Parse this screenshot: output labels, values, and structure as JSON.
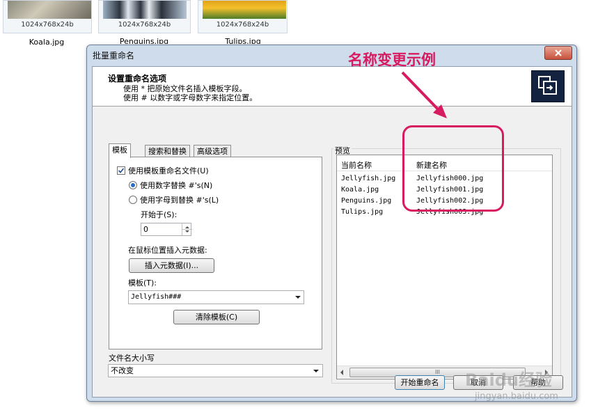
{
  "thumbnails": [
    {
      "name": "Koala.jpg",
      "dims": "1024x768x24b"
    },
    {
      "name": "Penguins.jpg",
      "dims": "1024x768x24b"
    },
    {
      "name": "Tulips.jpg",
      "dims": "1024x768x24b"
    }
  ],
  "dialog": {
    "title": "批量重命名",
    "header_title": "设置重命名选项",
    "header_line1": "使用 * 把原始文件名插入模板字段。",
    "header_line2": "使用 # 以数字或字母数字来指定位置。"
  },
  "tabs": [
    "模板",
    "搜索和替换",
    "高级选项"
  ],
  "template_tab": {
    "use_template_label": "使用模板重命名文件(U)",
    "use_template_checked": true,
    "radio_numeric": "使用数字替换 #'s(N)",
    "radio_alpha": "使用字母到替换 #'s(L)",
    "selected_radio": "numeric",
    "start_label": "开始于(S):",
    "start_value": "0",
    "insert_meta_label": "在鼠标位置插入元数据:",
    "insert_meta_button": "插入元数据(I)...",
    "template_label": "模板(T):",
    "template_value": "Jellyfish###",
    "clear_button": "清除模板(C)"
  },
  "case": {
    "label": "文件名大小写",
    "value": "不改变"
  },
  "preview": {
    "label": "预览",
    "col_current": "当前名称",
    "col_new": "新建名称",
    "rows": [
      {
        "current": "Jellyfish.jpg",
        "new": "Jellyfish000.jpg"
      },
      {
        "current": "Koala.jpg",
        "new": "Jellyfish001.jpg"
      },
      {
        "current": "Penguins.jpg",
        "new": "Jellyfish002.jpg"
      },
      {
        "current": "Tulips.jpg",
        "new": "Jellyfish003.jpg"
      }
    ],
    "scroll_grip": "III"
  },
  "footer": {
    "start_button": "开始重命名",
    "cancel_button": "取消",
    "help_button": "帮助"
  },
  "annotation": {
    "text": "名称变更示例",
    "color": "#d81b60"
  },
  "watermark": {
    "brand": "Baidu经验",
    "url": "jingyan.baidu.com"
  }
}
